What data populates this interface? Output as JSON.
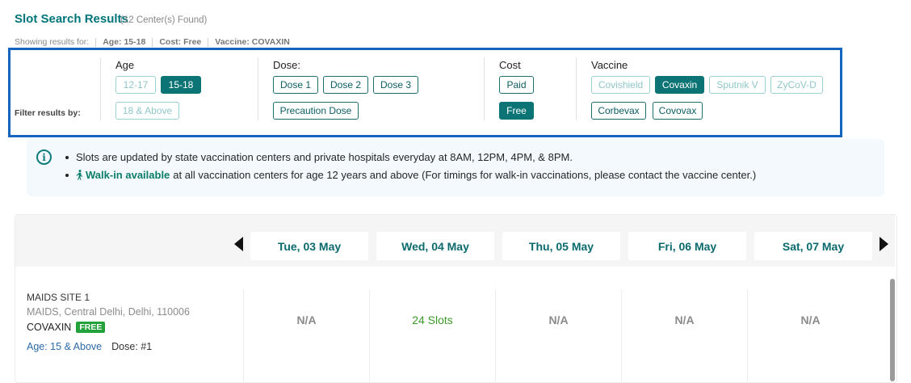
{
  "header": {
    "title": "Slot Search Results",
    "count": "(12 Center(s) Found)"
  },
  "showing": {
    "label": "Showing results for:",
    "age": "Age: 15-18",
    "cost": "Cost: Free",
    "vaccine": "Vaccine: COVAXIN"
  },
  "filters": {
    "label": "Filter results by:",
    "age": {
      "label": "Age",
      "options": [
        "12-17",
        "15-18",
        "18 & Above"
      ]
    },
    "dose": {
      "label": "Dose:",
      "options": [
        "Dose 1",
        "Dose 2",
        "Dose 3",
        "Precaution Dose"
      ]
    },
    "cost": {
      "label": "Cost",
      "options": [
        "Paid",
        "Free"
      ]
    },
    "vaccine": {
      "label": "Vaccine",
      "options": [
        "Covishield",
        "Covaxin",
        "Sputnik V",
        "ZyCoV-D",
        "Corbevax",
        "Covovax"
      ]
    }
  },
  "info": {
    "line1": "Slots are updated by state vaccination centers and private hospitals everyday at 8AM, 12PM, 4PM, & 8PM.",
    "walkin": "Walk-in available",
    "line2_rest": "at all vaccination centers for age 12 years and above (For timings for walk-in vaccinations, please contact the vaccine center.)"
  },
  "dates": [
    "Tue, 03 May",
    "Wed, 04 May",
    "Thu, 05 May",
    "Fri, 06 May",
    "Sat, 07 May"
  ],
  "center": {
    "name": "MAIDS SITE 1",
    "address": "MAIDS, Central Delhi, Delhi, 110006",
    "vaccine": "COVAXIN",
    "badge": "FREE",
    "age": "Age: 15 & Above",
    "dose": "Dose: #1",
    "slots": [
      "N/A",
      "24 Slots",
      "N/A",
      "N/A",
      "N/A"
    ]
  },
  "colors": {
    "accent": "#0d7476",
    "highlight_border": "#1565c0",
    "available": "#3e9a28",
    "badge": "#23a13a"
  }
}
